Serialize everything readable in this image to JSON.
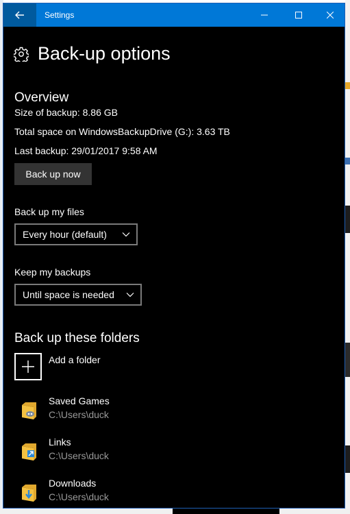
{
  "window": {
    "title": "Settings"
  },
  "page": {
    "title": "Back-up options"
  },
  "overview": {
    "heading": "Overview",
    "size_of_backup": "Size of backup: 8.86 GB",
    "total_space": "Total space on WindowsBackupDrive (G:): 3.63 TB",
    "last_backup": "Last backup: 29/01/2017 9:58 AM",
    "back_up_now_label": "Back up now"
  },
  "backup_files": {
    "label": "Back up my files",
    "selected": "Every hour (default)"
  },
  "keep_backups": {
    "label": "Keep my backups",
    "selected": "Until space is needed"
  },
  "folders": {
    "heading": "Back up these folders",
    "add_label": "Add a folder",
    "items": [
      {
        "name": "Saved Games",
        "path": "C:\\Users\\duck",
        "icon": "saved-games-folder-icon"
      },
      {
        "name": "Links",
        "path": "C:\\Users\\duck",
        "icon": "links-folder-icon"
      },
      {
        "name": "Downloads",
        "path": "C:\\Users\\duck",
        "icon": "downloads-folder-icon"
      }
    ]
  },
  "colors": {
    "titlebar": "#0078d7",
    "background": "#000000",
    "button": "#333333",
    "secondary_text": "#9a9a9a"
  }
}
